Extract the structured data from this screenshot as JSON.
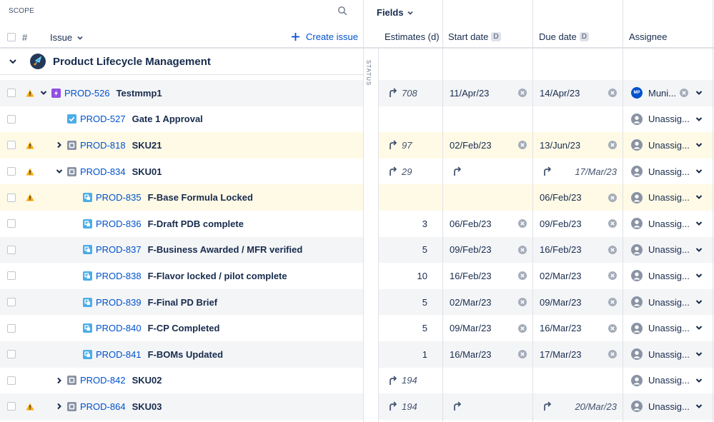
{
  "scope_label": "SCOPE",
  "fields_label": "Fields",
  "header": {
    "hash": "#",
    "issue_label": "Issue",
    "create_issue": "Create issue",
    "columns": {
      "estimates": "Estimates (d)",
      "start_date": "Start date",
      "due_date": "Due date",
      "assignee": "Assignee",
      "date_badge": "D"
    }
  },
  "status_label": "STATUS",
  "group": {
    "title": "Product Lifecycle Management"
  },
  "rows": [
    {
      "key": "PROD-526",
      "summary": "Testmmp1",
      "indent": 0,
      "type": "epic",
      "expand": "down",
      "warn": true,
      "yellow": false,
      "estimate": "708",
      "estimate_rollup": true,
      "start": "11/Apr/23",
      "start_rollup": false,
      "start_clear": true,
      "due": "14/Apr/23",
      "due_rollup": false,
      "due_clear": true,
      "assignee": "Muni...",
      "assignee_initials": "MP",
      "assignee_clear": true
    },
    {
      "key": "PROD-527",
      "summary": "Gate 1 Approval",
      "indent": 1,
      "type": "task",
      "expand": "",
      "warn": false,
      "yellow": false,
      "estimate": "",
      "estimate_rollup": false,
      "start": "",
      "start_rollup": false,
      "start_clear": false,
      "due": "",
      "due_rollup": false,
      "due_clear": false,
      "assignee": "Unassig...",
      "assignee_initials": "",
      "assignee_clear": false
    },
    {
      "key": "PROD-818",
      "summary": "SKU21",
      "indent": 1,
      "type": "story",
      "expand": "right",
      "warn": true,
      "yellow": true,
      "estimate": "97",
      "estimate_rollup": true,
      "start": "02/Feb/23",
      "start_rollup": false,
      "start_clear": true,
      "due": "13/Jun/23",
      "due_rollup": false,
      "due_clear": true,
      "assignee": "Unassig...",
      "assignee_initials": "",
      "assignee_clear": false
    },
    {
      "key": "PROD-834",
      "summary": "SKU01",
      "indent": 1,
      "type": "story",
      "expand": "down",
      "warn": true,
      "yellow": false,
      "estimate": "29",
      "estimate_rollup": true,
      "start": "",
      "start_rollup": true,
      "start_clear": false,
      "due": "17/Mar/23",
      "due_rollup": true,
      "due_clear": false,
      "assignee": "Unassig...",
      "assignee_initials": "",
      "assignee_clear": false
    },
    {
      "key": "PROD-835",
      "summary": "F-Base Formula Locked",
      "indent": 2,
      "type": "subtask",
      "expand": "",
      "warn": true,
      "yellow": true,
      "estimate": "",
      "estimate_rollup": false,
      "start": "",
      "start_rollup": false,
      "start_clear": false,
      "due": "06/Feb/23",
      "due_rollup": false,
      "due_clear": true,
      "assignee": "Unassig...",
      "assignee_initials": "",
      "assignee_clear": false
    },
    {
      "key": "PROD-836",
      "summary": "F-Draft PDB complete",
      "indent": 2,
      "type": "subtask",
      "expand": "",
      "warn": false,
      "yellow": false,
      "estimate": "3",
      "estimate_rollup": false,
      "start": "06/Feb/23",
      "start_rollup": false,
      "start_clear": true,
      "due": "09/Feb/23",
      "due_rollup": false,
      "due_clear": true,
      "assignee": "Unassig...",
      "assignee_initials": "",
      "assignee_clear": false
    },
    {
      "key": "PROD-837",
      "summary": "F-Business Awarded / MFR verified",
      "indent": 2,
      "type": "subtask",
      "expand": "",
      "warn": false,
      "yellow": false,
      "estimate": "5",
      "estimate_rollup": false,
      "start": "09/Feb/23",
      "start_rollup": false,
      "start_clear": true,
      "due": "16/Feb/23",
      "due_rollup": false,
      "due_clear": true,
      "assignee": "Unassig...",
      "assignee_initials": "",
      "assignee_clear": false
    },
    {
      "key": "PROD-838",
      "summary": "F-Flavor locked / pilot complete",
      "indent": 2,
      "type": "subtask",
      "expand": "",
      "warn": false,
      "yellow": false,
      "estimate": "10",
      "estimate_rollup": false,
      "start": "16/Feb/23",
      "start_rollup": false,
      "start_clear": true,
      "due": "02/Mar/23",
      "due_rollup": false,
      "due_clear": true,
      "assignee": "Unassig...",
      "assignee_initials": "",
      "assignee_clear": false
    },
    {
      "key": "PROD-839",
      "summary": "F-Final PD Brief",
      "indent": 2,
      "type": "subtask",
      "expand": "",
      "warn": false,
      "yellow": false,
      "estimate": "5",
      "estimate_rollup": false,
      "start": "02/Mar/23",
      "start_rollup": false,
      "start_clear": true,
      "due": "09/Mar/23",
      "due_rollup": false,
      "due_clear": true,
      "assignee": "Unassig...",
      "assignee_initials": "",
      "assignee_clear": false
    },
    {
      "key": "PROD-840",
      "summary": "F-CP Completed",
      "indent": 2,
      "type": "subtask",
      "expand": "",
      "warn": false,
      "yellow": false,
      "estimate": "5",
      "estimate_rollup": false,
      "start": "09/Mar/23",
      "start_rollup": false,
      "start_clear": true,
      "due": "16/Mar/23",
      "due_rollup": false,
      "due_clear": true,
      "assignee": "Unassig...",
      "assignee_initials": "",
      "assignee_clear": false
    },
    {
      "key": "PROD-841",
      "summary": "F-BOMs Updated",
      "indent": 2,
      "type": "subtask",
      "expand": "",
      "warn": false,
      "yellow": false,
      "estimate": "1",
      "estimate_rollup": false,
      "start": "16/Mar/23",
      "start_rollup": false,
      "start_clear": true,
      "due": "17/Mar/23",
      "due_rollup": false,
      "due_clear": true,
      "assignee": "Unassig...",
      "assignee_initials": "",
      "assignee_clear": false
    },
    {
      "key": "PROD-842",
      "summary": "SKU02",
      "indent": 1,
      "type": "story",
      "expand": "right",
      "warn": false,
      "yellow": false,
      "estimate": "194",
      "estimate_rollup": true,
      "start": "",
      "start_rollup": false,
      "start_clear": false,
      "due": "",
      "due_rollup": false,
      "due_clear": false,
      "assignee": "Unassig...",
      "assignee_initials": "",
      "assignee_clear": false
    },
    {
      "key": "PROD-864",
      "summary": "SKU03",
      "indent": 1,
      "type": "story",
      "expand": "right",
      "warn": true,
      "yellow": false,
      "estimate": "194",
      "estimate_rollup": true,
      "start": "",
      "start_rollup": true,
      "start_clear": false,
      "due": "20/Mar/23",
      "due_rollup": true,
      "due_clear": false,
      "assignee": "Unassig...",
      "assignee_initials": "",
      "assignee_clear": false
    }
  ],
  "colors": {
    "row_alt": "#f4f5f7",
    "row_warn": "#fffae6",
    "link": "#0052cc",
    "warn": "#ffab00",
    "epic": "#6554c0",
    "task": "#4bade8",
    "border": "#dfe1e6"
  }
}
